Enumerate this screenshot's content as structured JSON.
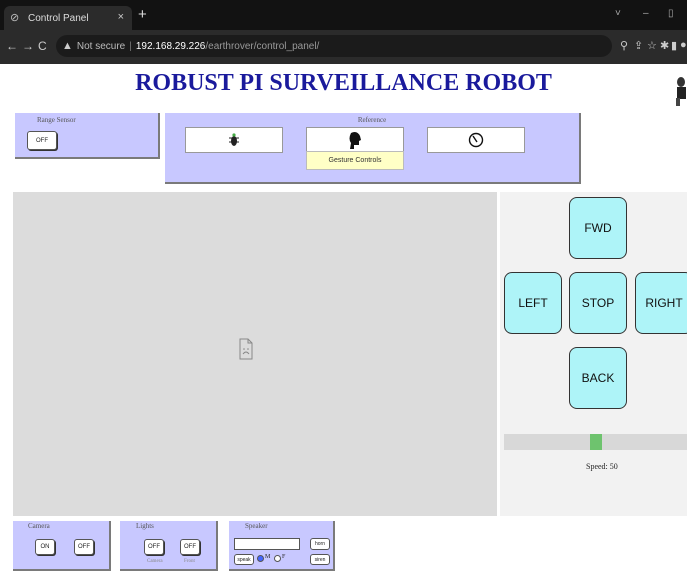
{
  "browser": {
    "tab_title": "Control Panel",
    "tab_close": "×",
    "new_tab": "+",
    "security_label": "Not secure",
    "url_host": "192.168.29.226",
    "url_path": "/earthrover/control_panel/",
    "window_controls": [
      "˅",
      "–",
      "☐"
    ]
  },
  "page": {
    "title": "ROBUST PI SURVEILLANCE ROBOT"
  },
  "range_sensor": {
    "label": "Range Sensor",
    "button": "OFF"
  },
  "reference": {
    "label": "Reference",
    "gesture_label": "Gesture Controls"
  },
  "drive": {
    "fwd": "FWD",
    "left": "LEFT",
    "stop": "STOP",
    "right": "RIGHT",
    "back": "BACK",
    "speed_label": "Speed: 50",
    "speed_value": 50,
    "speed_max": 100
  },
  "camera": {
    "label": "Camera",
    "on": "ON",
    "off": "OFF"
  },
  "lights": {
    "label": "Lights",
    "btn1": "OFF",
    "btn2": "OFF",
    "sub1": "Camera",
    "sub2": "Front"
  },
  "speaker": {
    "label": "Speaker",
    "send": "speak",
    "horn": "horn",
    "siren": "siren",
    "opt_m": "M",
    "opt_f": "F"
  },
  "colors": {
    "panel": "#c8c8ff",
    "drive_button": "#aef4f8",
    "title": "#1a1a9c",
    "slider_thumb": "#6ec36e"
  }
}
